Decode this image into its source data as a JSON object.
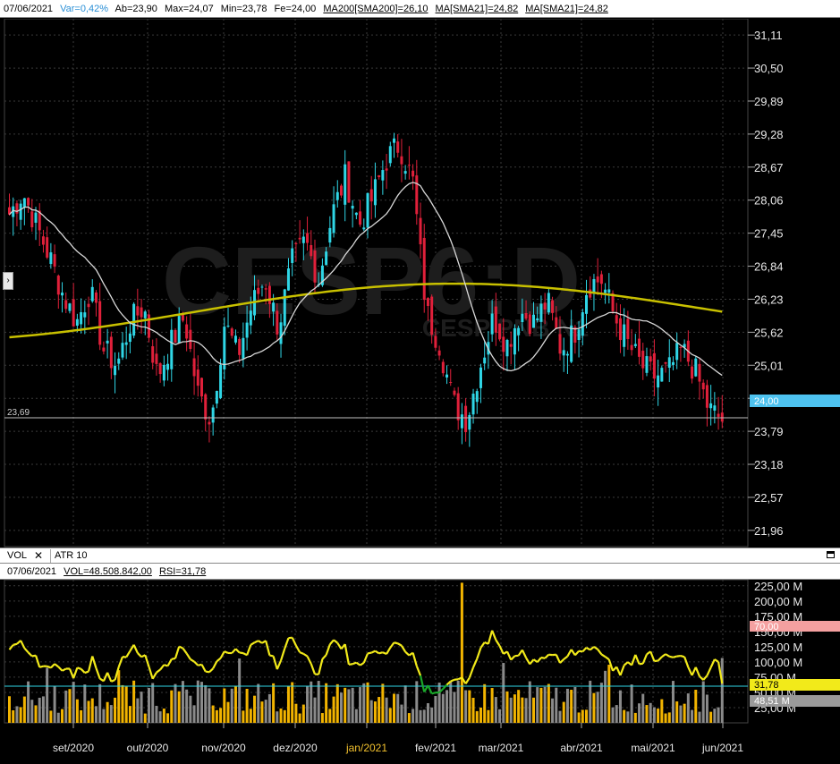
{
  "price_header": {
    "date": "07/06/2021",
    "var": "Var=0,42%",
    "open": "Ab=23,90",
    "max": "Max=24,07",
    "min": "Min=23,78",
    "close": "Fe=24,00",
    "ma200": "MA200[SMA200]=26,10",
    "ma21a": "MA[SMA21]=24,82",
    "ma21b": "MA[SMA21]=24,82"
  },
  "watermark": {
    "symbol": "CESP6:D",
    "subtitle": "CESP PNB N1"
  },
  "price_axis": {
    "ticks": [
      "31,11",
      "30,50",
      "29,89",
      "29,28",
      "28,67",
      "28,06",
      "27,45",
      "26,84",
      "26,23",
      "25,62",
      "25,01",
      "24,40",
      "23,79",
      "23,18",
      "22,57",
      "21,96"
    ],
    "last_price_label": "24,00",
    "min_line_label": "23,69"
  },
  "pane_tabs": {
    "vol": "VOL",
    "close": "✕",
    "atr": "ATR 10"
  },
  "volume_header": {
    "date": "07/06/2021",
    "vol": "VOL=48.508.842,00",
    "rsi": "RSI=31,78"
  },
  "volume_axis": {
    "ticks": [
      "225,00 M",
      "200,00 M",
      "175,00 M",
      "150,00 M",
      "125,00 M",
      "100,00 M",
      "75,00 M",
      "50,00 M",
      "25,00 M"
    ],
    "rsi_level_label": "70,00",
    "rsi_label": "31,78",
    "vol_label": "48,51 M"
  },
  "time_axis": [
    "set/2020",
    "out/2020",
    "nov/2020",
    "dez/2020",
    "jan/2021",
    "fev/2021",
    "mar/2021",
    "abr/2021",
    "mai/2021",
    "jun/2021"
  ],
  "colors": {
    "up": "#2fd6e6",
    "down": "#e0203a",
    "ma200": "#c8c000",
    "ma21": "#d8d8d8",
    "grid": "#3a3a3a",
    "rsi": "#f2ea1a",
    "rsi_over": "#e02030",
    "rsi_under": "#1aa82a",
    "vol_up": "#f2b400",
    "vol_down": "#8a8a8a",
    "last_price_bg": "#4ec3f0"
  },
  "chart_data": {
    "type": "candlestick",
    "title": "CESP6:D",
    "ylim": [
      21.66,
      31.41
    ],
    "months": [
      "set/2020",
      "out/2020",
      "nov/2020",
      "dez/2020",
      "jan/2021",
      "fev/2021",
      "mar/2021",
      "abr/2021",
      "mai/2021",
      "jun/2021"
    ],
    "close_path": [
      27.8,
      28.2,
      27.6,
      27.0,
      26.3,
      25.8,
      26.4,
      25.3,
      25.0,
      25.8,
      26.1,
      24.8,
      25.4,
      25.9,
      24.5,
      24.0,
      25.8,
      25.2,
      26.1,
      26.6,
      25.7,
      26.9,
      27.3,
      26.6,
      27.8,
      28.5,
      27.6,
      28.1,
      28.8,
      29.1,
      28.4,
      26.0,
      25.4,
      24.3,
      24.0,
      25.0,
      25.9,
      25.4,
      26.0,
      25.8,
      26.2,
      25.3,
      25.6,
      26.5,
      26.6,
      25.9,
      25.4,
      25.0,
      24.8,
      24.9,
      25.3,
      24.9,
      24.2,
      24.0
    ],
    "volume_ylim": [
      0,
      235
    ],
    "rsi_current": 31.78,
    "volume_current_M": 48.51
  }
}
